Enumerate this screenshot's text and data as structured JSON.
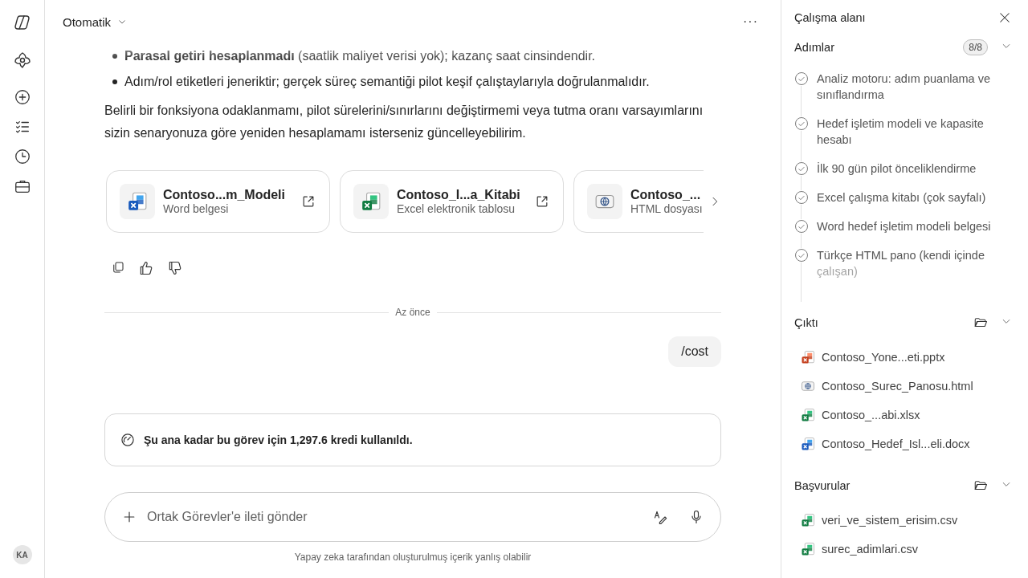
{
  "header": {
    "mode": "Otomatik",
    "more": "···"
  },
  "message": {
    "bullets": [
      "**Parasal getiri hesaplanmadı** (saatlik maliyet verisi yok); kazanç saat cinsindendir.",
      "Adım/rol etiketleri jeneriktir; gerçek süreç semantiği pilot keşif çalıştaylarıyla doğrulanmalıdır."
    ],
    "paragraph": "Belirli bir fonksiyona odaklanmamı, pilot sürelerini/sınırlarını değiştirmemi veya tutma oranı varsayımlarını sizin senaryonuza göre yeniden hesaplamamı isterseniz güncelleyebilirim."
  },
  "files": [
    {
      "kind": "word",
      "name": "Contoso...m_Modeli",
      "type": "Word belgesi"
    },
    {
      "kind": "excel",
      "name": "Contoso_I...a_Kitabi",
      "type": "Excel elektronik tablosu"
    },
    {
      "kind": "html",
      "name": "Contoso_...",
      "type": "HTML dosyası"
    }
  ],
  "divider": "Az önce",
  "user_message": "/cost",
  "notice": "Şu ana kadar bu görev için 1,297.6 kredi kullanıldı.",
  "composer": {
    "placeholder": "Ortak Görevler'e ileti gönder"
  },
  "disclaimer": "Yapay zeka tarafından oluşturulmuş içerik yanlış olabilir",
  "user": {
    "initials": "KA"
  },
  "workspace": {
    "title": "Çalışma alanı",
    "steps": {
      "title": "Adımlar",
      "count": "8/8",
      "expanded": true,
      "items": [
        {
          "label": "Analiz motoru: adım puanlama ve sınıflandırma",
          "done": true
        },
        {
          "label": "Hedef işletim modeli ve kapasite hesabı",
          "done": true
        },
        {
          "label": "İlk 90 gün pilot önceliklendirme",
          "done": true
        },
        {
          "label": "Excel çalışma kitabı (çok sayfalı)",
          "done": true
        },
        {
          "label": "Word hedef işletim modeli belgesi",
          "done": true
        },
        {
          "label": "Türkçe HTML pano (kendi içinde çalışan)",
          "done": true
        }
      ]
    },
    "output": {
      "title": "Çıktı",
      "expanded": true,
      "files": [
        {
          "kind": "pptx",
          "name": "Contoso_Yone...eti.pptx"
        },
        {
          "kind": "html",
          "name": "Contoso_Surec_Panosu.html"
        },
        {
          "kind": "excel",
          "name": "Contoso_...abi.xlsx"
        },
        {
          "kind": "word",
          "name": "Contoso_Hedef_Isl...eli.docx"
        }
      ]
    },
    "references": {
      "title": "Başvurular",
      "expanded": true,
      "files": [
        {
          "kind": "csv",
          "name": "veri_ve_sistem_erisim.csv"
        },
        {
          "kind": "csv",
          "name": "surec_adimlari.csv"
        }
      ]
    }
  }
}
